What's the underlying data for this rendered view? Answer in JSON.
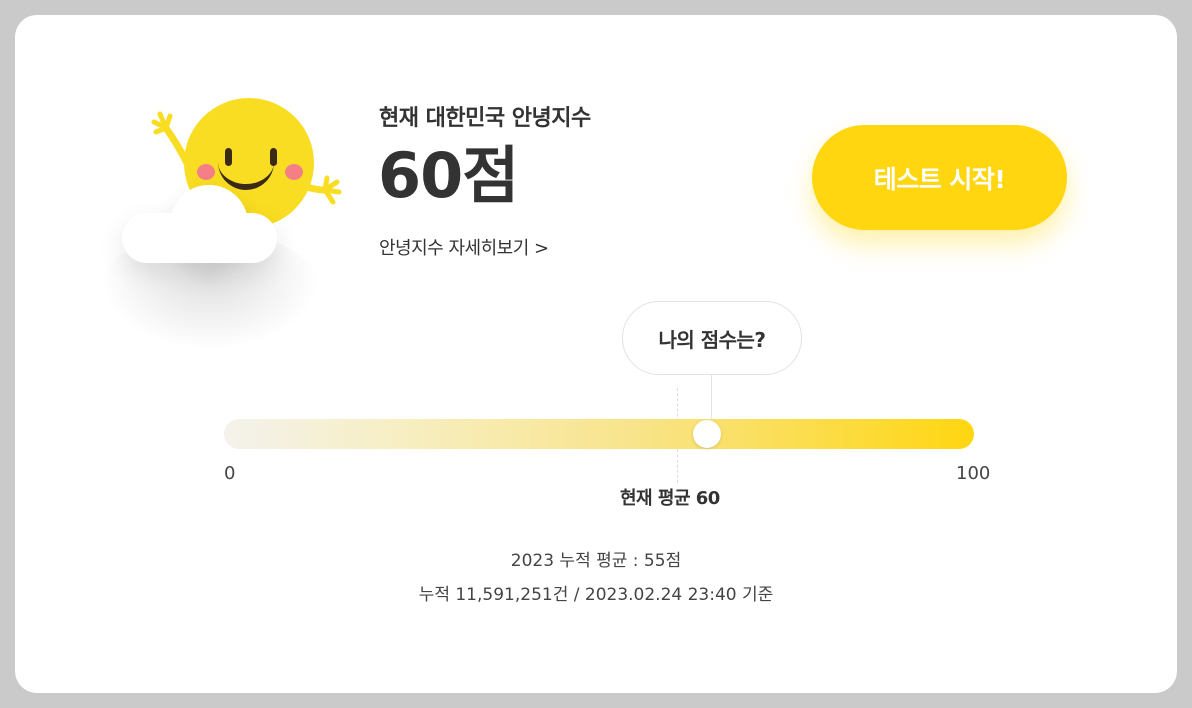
{
  "header": {
    "subtitle": "현재 대한민국 안녕지수",
    "score": "60점",
    "detail_link": "안녕지수 자세히보기 >"
  },
  "cta": {
    "label": "테스트 시작!"
  },
  "gauge": {
    "bubble_label": "나의 점수는?",
    "min_label": "0",
    "max_label": "100",
    "min": 0,
    "max": 100,
    "my_score": 65,
    "average": 60,
    "average_label": "현재 평균 60"
  },
  "stats": {
    "yearly_average": "2023 누적 평균 : 55점",
    "cumulative": "누적 11,591,251건 / 2023.02.24 23:40 기준"
  },
  "colors": {
    "accent": "#ffd610",
    "page_bg": "#cacaca",
    "card_bg": "#ffffff",
    "text": "#333333",
    "sun": "#f9dd22",
    "cheek": "#f57f87"
  },
  "icons": {
    "mascot": "smiling-sun-on-cloud-icon"
  }
}
